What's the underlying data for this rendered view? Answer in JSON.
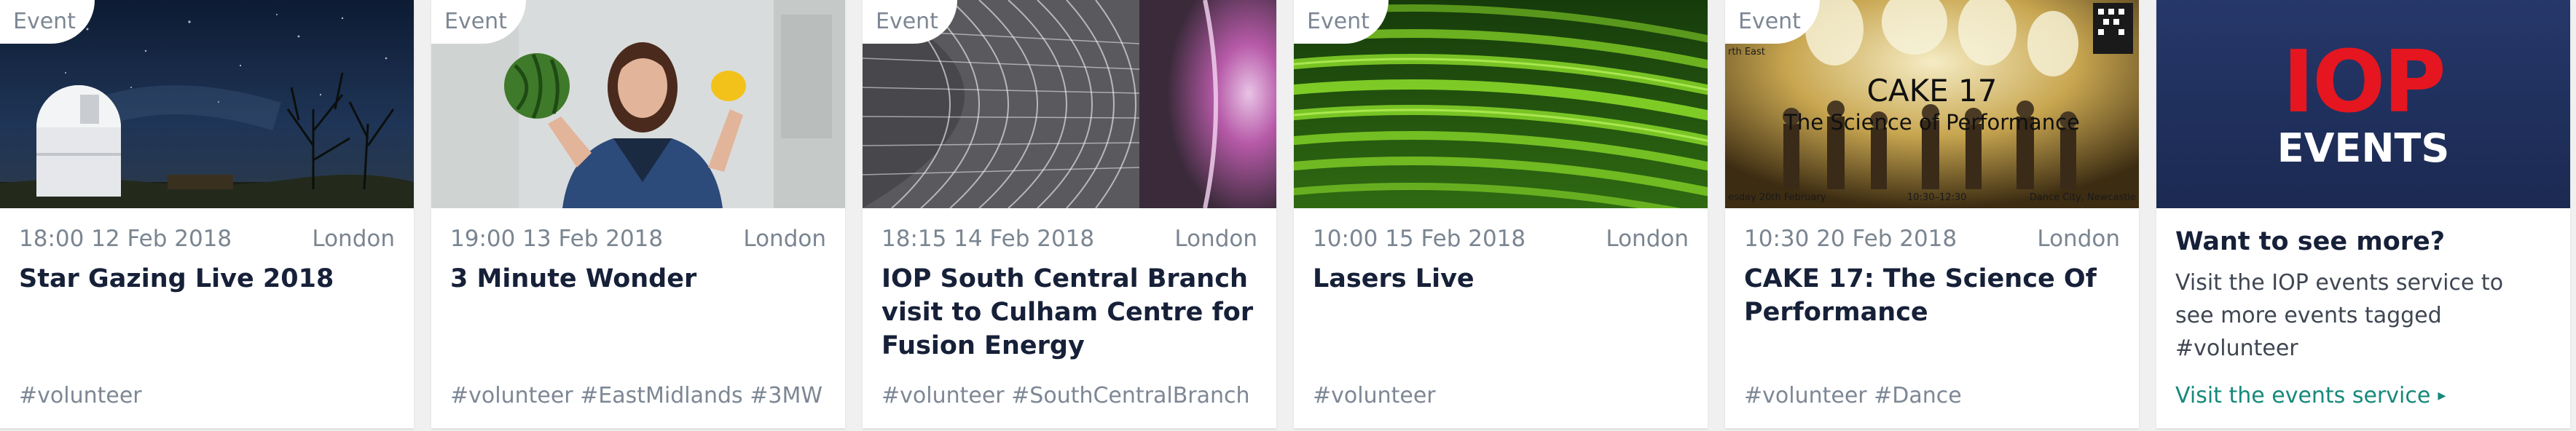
{
  "events": [
    {
      "badge": "Event",
      "time": "18:00 12 Feb 2018",
      "location": "London",
      "title": "Star Gazing Live 2018",
      "tags": "#volunteer"
    },
    {
      "badge": "Event",
      "time": "19:00 13 Feb 2018",
      "location": "London",
      "title": "3 Minute Wonder",
      "tags": "#volunteer #EastMidlands #3MW"
    },
    {
      "badge": "Event",
      "time": "18:15 14 Feb 2018",
      "location": "London",
      "title": "IOP South Central Branch visit to Culham Centre for Fusion Energy",
      "tags": "#volunteer #SouthCentralBranch"
    },
    {
      "badge": "Event",
      "time": "10:00 15 Feb 2018",
      "location": "London",
      "title": "Lasers Live",
      "tags": "#volunteer"
    },
    {
      "badge": "Event",
      "time": "10:30 20 Feb 2018",
      "location": "London",
      "title": "CAKE 17: The Science Of Performance",
      "tags": "#volunteer #Dance",
      "image_text": {
        "title": "CAKE 17",
        "subtitle": "The Science of Performance",
        "top_left": "rth East",
        "bottom_left": "esday 20th February",
        "bottom_center": "10:30–12:30",
        "bottom_right": "Dance City, Newcastle"
      }
    }
  ],
  "more": {
    "logo_text": "IOP",
    "logo_sub": "EVENTS",
    "title": "Want to see more?",
    "text": "Visit the IOP events service to see more events tagged #volunteer",
    "link": "Visit the events service",
    "link_arrow": "▸"
  },
  "colors": {
    "title": "#162038",
    "meta": "#7a8591",
    "link": "#16897a",
    "iop_red": "#e5161f",
    "iop_navy": "#1f2f5c"
  }
}
